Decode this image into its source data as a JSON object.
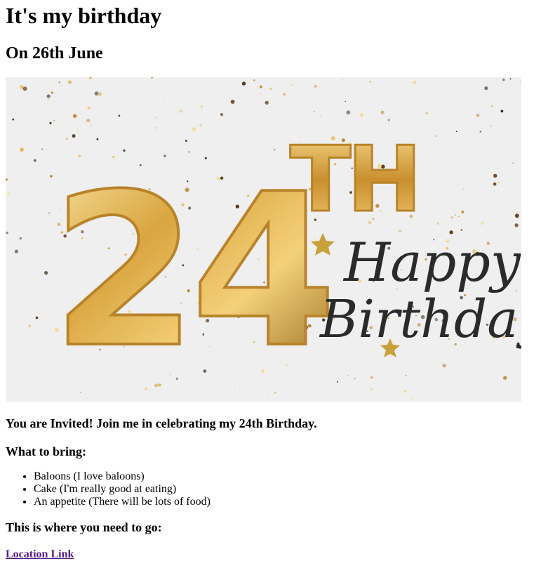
{
  "page": {
    "title": "It's my birthday",
    "date": "On 26th June"
  },
  "hero_image": {
    "number": "24",
    "suffix": "TH",
    "script_line1": "Happy",
    "script_line2": "Birthday",
    "colors": {
      "gold": "#D9A640",
      "gold_light": "#F6DA8E",
      "gold_dark": "#8E6418",
      "background": "#EFEFEF",
      "script": "#2A2A2A",
      "confetti_dark": "#5A3410"
    }
  },
  "invitation": "You are Invited! Join me in celebrating my 24th Birthday.",
  "bring": {
    "heading": "What to bring:",
    "items": [
      "Baloons (I love baloons)",
      "Cake (I'm really good at eating)",
      "An appetite (There will be lots of food)"
    ]
  },
  "location": {
    "heading": "This is where you need to go:",
    "link_text": "Location Link",
    "link_color": "#551A8B"
  }
}
